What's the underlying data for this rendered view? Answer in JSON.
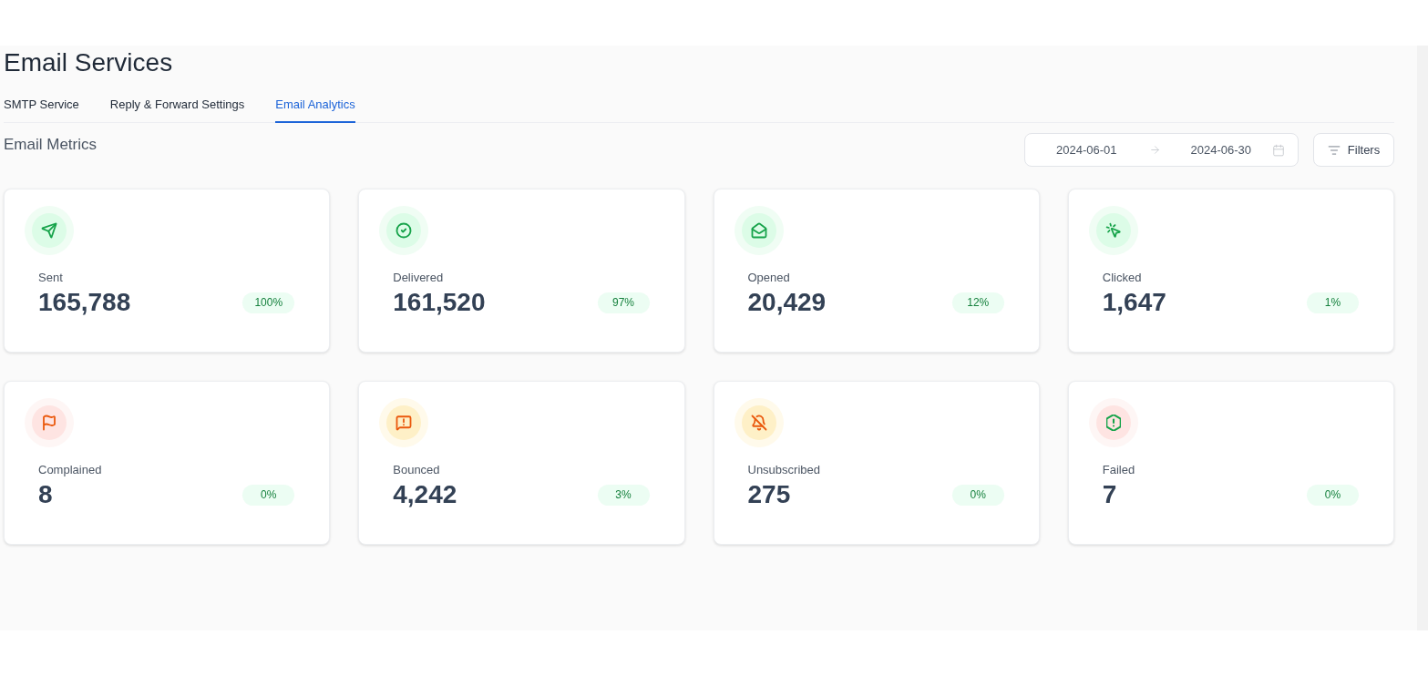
{
  "page": {
    "title": "Email Services"
  },
  "tabs": [
    {
      "label": "SMTP Service",
      "selected": false
    },
    {
      "label": "Reply & Forward Settings",
      "selected": false
    },
    {
      "label": "Email Analytics",
      "selected": true
    }
  ],
  "section": {
    "title": "Email Metrics",
    "date_range": {
      "start": "2024-06-01",
      "end": "2024-06-30"
    },
    "filters_button": "Filters"
  },
  "metrics": [
    {
      "label": "Sent",
      "value": "165,788",
      "percent": "100%",
      "color": "#16a34a"
    },
    {
      "label": "Delivered",
      "value": "161,520",
      "percent": "97%",
      "color": "#16a34a"
    },
    {
      "label": "Opened",
      "value": "20,429",
      "percent": "12%",
      "color": "#16a34a"
    },
    {
      "label": "Clicked",
      "value": "1,647",
      "percent": "1%",
      "color": "#16a34a"
    },
    {
      "label": "Complained",
      "value": "8",
      "percent": "0%",
      "color": "#ea580c"
    },
    {
      "label": "Bounced",
      "value": "4,242",
      "percent": "3%",
      "color": "#ea580c"
    },
    {
      "label": "Unsubscribed",
      "value": "275",
      "percent": "0%",
      "color": "#ea580c"
    },
    {
      "label": "Failed",
      "value": "7",
      "percent": "0%",
      "color": "#16a34a"
    }
  ]
}
